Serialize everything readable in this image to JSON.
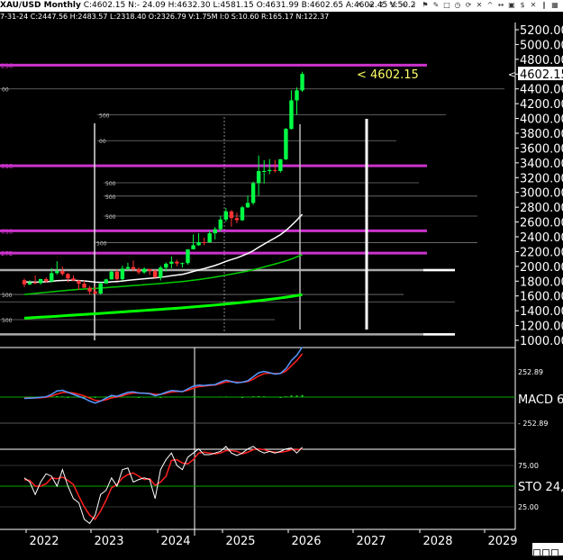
{
  "header": {
    "symbol": "XAU/USD Monthly",
    "ohlc": "C:4602.15 N:- 24.09 H:4632.30 L:4581.15 O:4631.99 B:4602.65 A:4602.45 V:50.2",
    "sub": "7-31-24 C:2447.56 H:2483.57 L:2318.40 O:2326.79 V:1.75M I:0 S:10.60 R:165.17 N:122.37",
    "icons": [
      "arrow-icon",
      "bars-icon",
      "sum-icon",
      "percent-icon",
      "wave-icon",
      "info-icon",
      "flag-icon",
      "pencil-icon",
      "frame-icon",
      "clock-icon",
      "cycle-icon",
      "cross-icon",
      "caret-icon",
      "arrows-icon",
      "lock-icon",
      "dollar-icon",
      "trash-icon",
      "draw-icon",
      "grid-icon"
    ]
  },
  "colors": {
    "background": "#000000",
    "up_candle": "#00ff44",
    "down_candle": "#ff3333",
    "magenta_levels": "#cc33cc",
    "macd_line": "#5599ff",
    "signal_line": "#ff2020",
    "stoch_k": "#ffffff",
    "stoch_d": "#ff2020",
    "level_line": "#888888",
    "price_tag": "#ffff66"
  },
  "price_label": "< 4602.15",
  "last_price": "4602.15",
  "chart_data": {
    "type": "candlestick",
    "title": "XAU/USD Monthly",
    "x_labels": [
      "2022",
      "2023",
      "2024",
      "2025",
      "2026",
      "2027",
      "2028",
      "2029"
    ],
    "y_ticks": [
      "5200.00",
      "5000.00",
      "4800.00",
      "4600.00",
      "4400.00",
      "4200.00",
      "4000.00",
      "3800.00",
      "3600.00",
      "3400.00",
      "3200.00",
      "3000.00",
      "2800.00",
      "2600.00",
      "2400.00",
      "2200.00",
      "2000.00",
      "1800.00",
      "1600.00",
      "1400.00",
      "1200.00",
      "1000.00"
    ],
    "ylim": [
      1000,
      5300
    ],
    "candles": [
      {
        "t": "2021-09",
        "o": 1813,
        "h": 1834,
        "l": 1721,
        "c": 1757
      },
      {
        "t": "2021-10",
        "o": 1757,
        "h": 1813,
        "l": 1746,
        "c": 1783
      },
      {
        "t": "2021-11",
        "o": 1783,
        "h": 1877,
        "l": 1759,
        "c": 1774
      },
      {
        "t": "2021-12",
        "o": 1774,
        "h": 1830,
        "l": 1753,
        "c": 1829
      },
      {
        "t": "2022-01",
        "o": 1829,
        "h": 1853,
        "l": 1780,
        "c": 1797
      },
      {
        "t": "2022-02",
        "o": 1797,
        "h": 1974,
        "l": 1782,
        "c": 1909
      },
      {
        "t": "2022-03",
        "o": 1909,
        "h": 2070,
        "l": 1890,
        "c": 1937
      },
      {
        "t": "2022-04",
        "o": 1937,
        "h": 1998,
        "l": 1872,
        "c": 1897
      },
      {
        "t": "2022-05",
        "o": 1897,
        "h": 1910,
        "l": 1786,
        "c": 1837
      },
      {
        "t": "2022-06",
        "o": 1837,
        "h": 1879,
        "l": 1805,
        "c": 1807
      },
      {
        "t": "2022-07",
        "o": 1807,
        "h": 1814,
        "l": 1681,
        "c": 1766
      },
      {
        "t": "2022-08",
        "o": 1766,
        "h": 1808,
        "l": 1709,
        "c": 1711
      },
      {
        "t": "2022-09",
        "o": 1711,
        "h": 1735,
        "l": 1615,
        "c": 1660
      },
      {
        "t": "2022-10",
        "o": 1660,
        "h": 1730,
        "l": 1617,
        "c": 1633
      },
      {
        "t": "2022-11",
        "o": 1633,
        "h": 1786,
        "l": 1616,
        "c": 1768
      },
      {
        "t": "2022-12",
        "o": 1768,
        "h": 1833,
        "l": 1765,
        "c": 1824
      },
      {
        "t": "2023-01",
        "o": 1824,
        "h": 1949,
        "l": 1823,
        "c": 1928
      },
      {
        "t": "2023-02",
        "o": 1928,
        "h": 1959,
        "l": 1804,
        "c": 1827
      },
      {
        "t": "2023-03",
        "o": 1827,
        "h": 2009,
        "l": 1809,
        "c": 1969
      },
      {
        "t": "2023-04",
        "o": 1969,
        "h": 2048,
        "l": 1949,
        "c": 1990
      },
      {
        "t": "2023-05",
        "o": 1990,
        "h": 2079,
        "l": 1932,
        "c": 1962
      },
      {
        "t": "2023-06",
        "o": 1962,
        "h": 1983,
        "l": 1893,
        "c": 1919
      },
      {
        "t": "2023-07",
        "o": 1919,
        "h": 1987,
        "l": 1902,
        "c": 1965
      },
      {
        "t": "2023-08",
        "o": 1965,
        "h": 1966,
        "l": 1884,
        "c": 1940
      },
      {
        "t": "2023-09",
        "o": 1940,
        "h": 1953,
        "l": 1848,
        "c": 1849
      },
      {
        "t": "2023-10",
        "o": 1849,
        "h": 2009,
        "l": 1810,
        "c": 1983
      },
      {
        "t": "2023-11",
        "o": 1983,
        "h": 2052,
        "l": 1931,
        "c": 2036
      },
      {
        "t": "2023-12",
        "o": 2036,
        "h": 2135,
        "l": 1973,
        "c": 2063
      },
      {
        "t": "2024-01",
        "o": 2063,
        "h": 2088,
        "l": 2001,
        "c": 2039
      },
      {
        "t": "2024-02",
        "o": 2039,
        "h": 2052,
        "l": 1984,
        "c": 2044
      },
      {
        "t": "2024-03",
        "o": 2044,
        "h": 2222,
        "l": 2024,
        "c": 2230
      },
      {
        "t": "2024-04",
        "o": 2230,
        "h": 2431,
        "l": 2228,
        "c": 2286
      },
      {
        "t": "2024-05",
        "o": 2286,
        "h": 2450,
        "l": 2277,
        "c": 2327
      },
      {
        "t": "2024-06",
        "o": 2327,
        "h": 2387,
        "l": 2286,
        "c": 2326
      },
      {
        "t": "2024-07",
        "o": 2326,
        "h": 2483,
        "l": 2318,
        "c": 2447
      },
      {
        "t": "2024-08",
        "o": 2447,
        "h": 2531,
        "l": 2364,
        "c": 2503
      },
      {
        "t": "2024-09",
        "o": 2503,
        "h": 2685,
        "l": 2471,
        "c": 2634
      },
      {
        "t": "2024-10",
        "o": 2634,
        "h": 2790,
        "l": 2603,
        "c": 2743
      },
      {
        "t": "2024-11",
        "o": 2743,
        "h": 2761,
        "l": 2536,
        "c": 2653
      },
      {
        "t": "2024-12",
        "o": 2653,
        "h": 2726,
        "l": 2583,
        "c": 2624
      },
      {
        "t": "2025-01",
        "o": 2624,
        "h": 2817,
        "l": 2615,
        "c": 2798
      },
      {
        "t": "2025-02",
        "o": 2798,
        "h": 2956,
        "l": 2790,
        "c": 2858
      },
      {
        "t": "2025-03",
        "o": 2858,
        "h": 3148,
        "l": 2833,
        "c": 3124
      },
      {
        "t": "2025-04",
        "o": 3124,
        "h": 3500,
        "l": 2957,
        "c": 3288
      },
      {
        "t": "2025-05",
        "o": 3288,
        "h": 3435,
        "l": 3120,
        "c": 3289
      },
      {
        "t": "2025-06",
        "o": 3289,
        "h": 3451,
        "l": 3246,
        "c": 3303
      },
      {
        "t": "2025-07",
        "o": 3303,
        "h": 3439,
        "l": 3268,
        "c": 3290
      },
      {
        "t": "2025-08",
        "o": 3290,
        "h": 3453,
        "l": 3268,
        "c": 3448
      },
      {
        "t": "2025-09",
        "o": 3448,
        "h": 3871,
        "l": 3436,
        "c": 3858
      },
      {
        "t": "2025-10",
        "o": 3858,
        "h": 4381,
        "l": 3850,
        "c": 4245
      },
      {
        "t": "2025-11",
        "o": 4245,
        "h": 4420,
        "l": 4050,
        "c": 4380
      },
      {
        "t": "2025-12",
        "o": 4380,
        "h": 4632,
        "l": 4360,
        "c": 4602
      }
    ],
    "horizontal_levels": [
      {
        "value": 4720,
        "color": "#cc33cc",
        "label": "236"
      },
      {
        "value": 3360,
        "color": "#cc33cc",
        "label": "618"
      },
      {
        "value": 2480,
        "color": "#cc33cc",
        "label": "618"
      },
      {
        "value": 2180,
        "color": "#cc33cc",
        "label": "272"
      },
      {
        "value": 1950,
        "color": "#aaaaaa",
        "label": ""
      },
      {
        "value": 1080,
        "color": "#aaaaaa",
        "label": ""
      }
    ],
    "thin_levels": [
      {
        "value": 4400,
        "label": "00"
      },
      {
        "value": 4050,
        "label": "500"
      },
      {
        "value": 3700,
        "label": "00"
      },
      {
        "value": 3130,
        "label": "500"
      },
      {
        "value": 2950,
        "label": "500"
      },
      {
        "value": 2680,
        "label": "500"
      },
      {
        "value": 2320,
        "label": "500"
      },
      {
        "value": 1620,
        "label": "500"
      },
      {
        "value": 1520,
        "label": ""
      },
      {
        "value": 1280,
        "label": "500"
      }
    ],
    "moving_averages": [
      {
        "color": "#ffffff",
        "values": [
          1790,
          1788,
          1787,
          1789,
          1791,
          1797,
          1806,
          1810,
          1812,
          1811,
          1808,
          1803,
          1796,
          1787,
          1783,
          1785,
          1792,
          1795,
          1802,
          1811,
          1819,
          1825,
          1832,
          1839,
          1845,
          1852,
          1862,
          1873,
          1882,
          1892,
          1910,
          1931,
          1951,
          1970,
          1991,
          2012,
          2038,
          2068,
          2092,
          2115,
          2143,
          2174,
          2211,
          2258,
          2301,
          2344,
          2385,
          2429,
          2484,
          2552,
          2625,
          2705
        ]
      },
      {
        "color": "#00cc00",
        "values": [
          1620,
          1627,
          1634,
          1642,
          1649,
          1656,
          1663,
          1670,
          1677,
          1683,
          1689,
          1694,
          1698,
          1702,
          1707,
          1712,
          1718,
          1723,
          1729,
          1735,
          1741,
          1746,
          1752,
          1758,
          1763,
          1769,
          1775,
          1782,
          1788,
          1795,
          1803,
          1812,
          1822,
          1832,
          1843,
          1855,
          1868,
          1882,
          1895,
          1908,
          1922,
          1937,
          1954,
          1973,
          1992,
          2012,
          2032,
          2052,
          2074,
          2100,
          2128,
          2158
        ]
      },
      {
        "color": "#00ff00",
        "values": [
          1300,
          1305,
          1309,
          1313,
          1317,
          1321,
          1326,
          1331,
          1336,
          1341,
          1346,
          1350,
          1355,
          1359,
          1364,
          1369,
          1374,
          1379,
          1384,
          1389,
          1394,
          1399,
          1404,
          1409,
          1414,
          1419,
          1424,
          1429,
          1434,
          1440,
          1446,
          1452,
          1458,
          1464,
          1470,
          1477,
          1484,
          1491,
          1498,
          1505,
          1512,
          1520,
          1528,
          1536,
          1545,
          1554,
          1563,
          1573,
          1583,
          1594,
          1606,
          1618
        ]
      }
    ],
    "macd": {
      "label": "MACD 6,",
      "ticks": [
        "252.89",
        "- 252.89"
      ],
      "macd_values": [
        -10,
        -8,
        -6,
        -2,
        2,
        20,
        45,
        50,
        35,
        20,
        5,
        -10,
        -30,
        -45,
        -30,
        -8,
        12,
        5,
        20,
        35,
        38,
        30,
        28,
        25,
        10,
        20,
        35,
        48,
        45,
        40,
        60,
        80,
        88,
        85,
        90,
        92,
        110,
        125,
        115,
        105,
        110,
        120,
        150,
        180,
        190,
        180,
        170,
        175,
        210,
        270,
        310,
        370
      ],
      "signal_values": [
        -6,
        -7,
        -7,
        -5,
        -2,
        8,
        22,
        34,
        35,
        30,
        20,
        8,
        -8,
        -24,
        -28,
        -20,
        -6,
        0,
        10,
        22,
        30,
        30,
        29,
        27,
        20,
        20,
        27,
        37,
        41,
        41,
        50,
        65,
        77,
        81,
        86,
        89,
        100,
        112,
        114,
        110,
        110,
        115,
        132,
        156,
        173,
        177,
        174,
        175,
        192,
        231,
        270,
        320
      ],
      "hist_values": [
        -4,
        -1,
        1,
        3,
        4,
        12,
        23,
        16,
        0,
        -10,
        -15,
        -18,
        -22,
        -21,
        -2,
        12,
        18,
        5,
        10,
        13,
        8,
        0,
        -1,
        -2,
        -10,
        0,
        8,
        11,
        4,
        -1,
        10,
        15,
        11,
        4,
        4,
        3,
        10,
        13,
        1,
        -5,
        0,
        5,
        18,
        24,
        17,
        3,
        -4,
        0,
        18,
        39,
        40,
        50
      ]
    },
    "stochastic": {
      "label": "STO 24,",
      "ticks": [
        "75.00",
        "25.00"
      ],
      "k_values": [
        60,
        55,
        40,
        55,
        65,
        62,
        50,
        70,
        50,
        35,
        30,
        10,
        5,
        15,
        40,
        45,
        60,
        50,
        70,
        72,
        55,
        58,
        60,
        58,
        35,
        70,
        82,
        90,
        75,
        70,
        85,
        90,
        95,
        88,
        88,
        90,
        92,
        98,
        90,
        87,
        90,
        95,
        98,
        93,
        90,
        92,
        90,
        92,
        95,
        96,
        90,
        97
      ],
      "d_values": [
        58,
        57,
        50,
        50,
        53,
        60,
        59,
        61,
        57,
        52,
        38,
        25,
        15,
        10,
        20,
        33,
        48,
        52,
        60,
        64,
        66,
        62,
        58,
        59,
        51,
        55,
        62,
        81,
        82,
        78,
        77,
        82,
        90,
        91,
        90,
        89,
        90,
        93,
        93,
        92,
        89,
        91,
        94,
        95,
        94,
        92,
        91,
        91,
        92,
        94,
        94,
        95
      ]
    }
  }
}
